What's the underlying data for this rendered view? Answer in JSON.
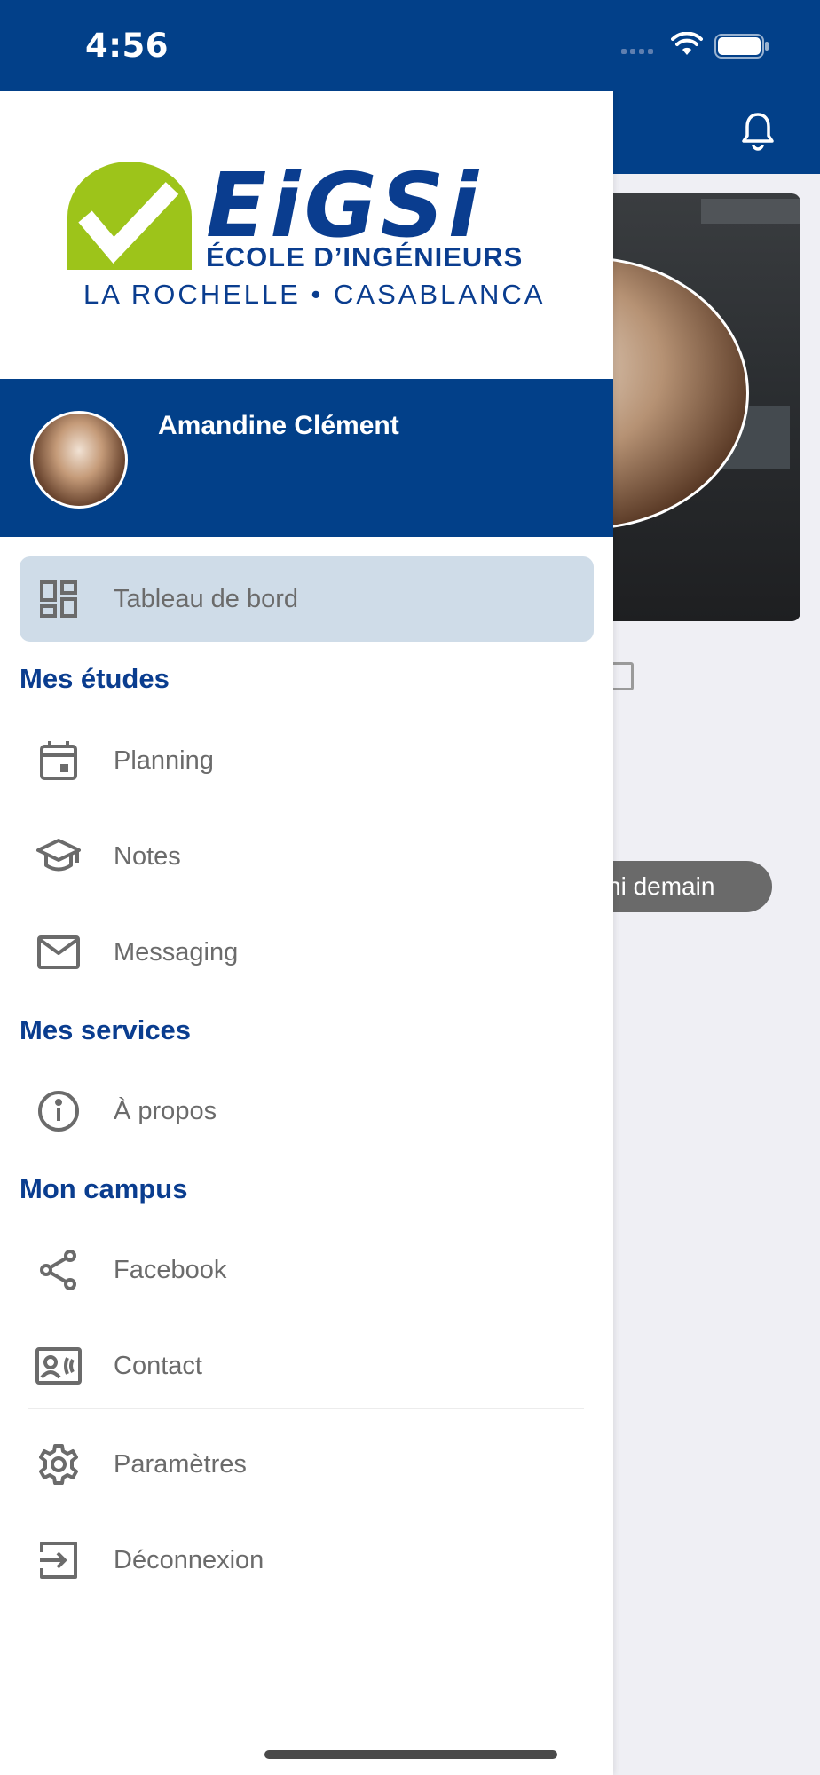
{
  "status_bar": {
    "time": "4:56"
  },
  "background": {
    "chip_text": "i ni demain"
  },
  "drawer": {
    "logo": {
      "wordmark": "EiGSi",
      "tagline": "ÉCOLE D’INGÉNIEURS",
      "locations": "LA ROCHELLE • CASABLANCA"
    },
    "profile": {
      "name": "Amandine Clément"
    },
    "dashboard": {
      "label": "Tableau de bord",
      "icon": "dashboard-icon"
    },
    "sections": [
      {
        "title": "Mes études",
        "items": [
          {
            "label": "Planning",
            "icon": "calendar-icon"
          },
          {
            "label": "Notes",
            "icon": "graduation-cap-icon"
          },
          {
            "label": "Messaging",
            "icon": "mail-icon"
          }
        ]
      },
      {
        "title": "Mes services",
        "items": [
          {
            "label": "À propos",
            "icon": "info-icon"
          }
        ]
      },
      {
        "title": "Mon campus",
        "items": [
          {
            "label": "Facebook",
            "icon": "share-icon"
          },
          {
            "label": "Contact",
            "icon": "contact-card-icon"
          }
        ]
      }
    ],
    "footer_items": [
      {
        "label": "Paramètres",
        "icon": "gear-icon"
      },
      {
        "label": "Déconnexion",
        "icon": "logout-icon"
      }
    ]
  },
  "colors": {
    "brand_blue": "#024089",
    "active_bg": "#cfdce8",
    "logo_green": "#9dc41a"
  }
}
